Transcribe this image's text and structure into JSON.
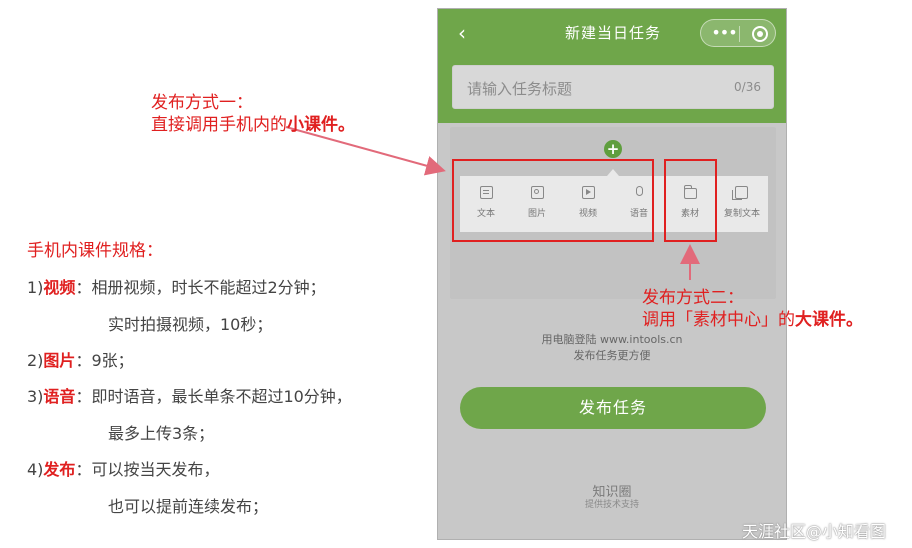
{
  "phone": {
    "title": "新建当日任务",
    "title_input": {
      "placeholder": "请输入任务标题",
      "counter": "0/36"
    },
    "plus": "+",
    "menu": [
      {
        "icon": "text-doc-icon",
        "label": "文本"
      },
      {
        "icon": "image-icon",
        "label": "图片"
      },
      {
        "icon": "video-icon",
        "label": "视频"
      },
      {
        "icon": "mic-icon",
        "label": "语音"
      },
      {
        "icon": "folder-icon",
        "label": "素材"
      },
      {
        "icon": "copy-icon",
        "label": "复制文本"
      }
    ],
    "pc_note_line1": "用电脑登陆 www.intools.cn",
    "pc_note_line2": "发布任务更方便",
    "publish_label": "发布任务",
    "brand": "知识圈",
    "brand_sub": "提供技术支持"
  },
  "annotations": {
    "method1_title": "发布方式一：",
    "method1_desc": "直接调用手机内的",
    "method1_bold": "小课件。",
    "method2_title": "发布方式二：",
    "method2_desc": "调用「素材中心」的",
    "method2_bold": "大课件。"
  },
  "specs": {
    "title": "手机内课件规格：",
    "items": [
      {
        "num": "1)",
        "key": "视频",
        "text": "：相册视频，时长不能超过2分钟；",
        "cont": "实时拍摄视频，10秒；"
      },
      {
        "num": "2)",
        "key": "图片",
        "text": "：9张；",
        "cont": ""
      },
      {
        "num": "3)",
        "key": "语音",
        "text": "：即时语音，最长单条不超过10分钟，",
        "cont": "最多上传3条；"
      },
      {
        "num": "4)",
        "key": "发布",
        "text": "：可以按当天发布，",
        "cont": "也可以提前连续发布；"
      }
    ]
  },
  "watermark": "天涯社区@小知看图",
  "colors": {
    "accent_green": "#6fa64a",
    "annotation_red": "#e02020"
  }
}
